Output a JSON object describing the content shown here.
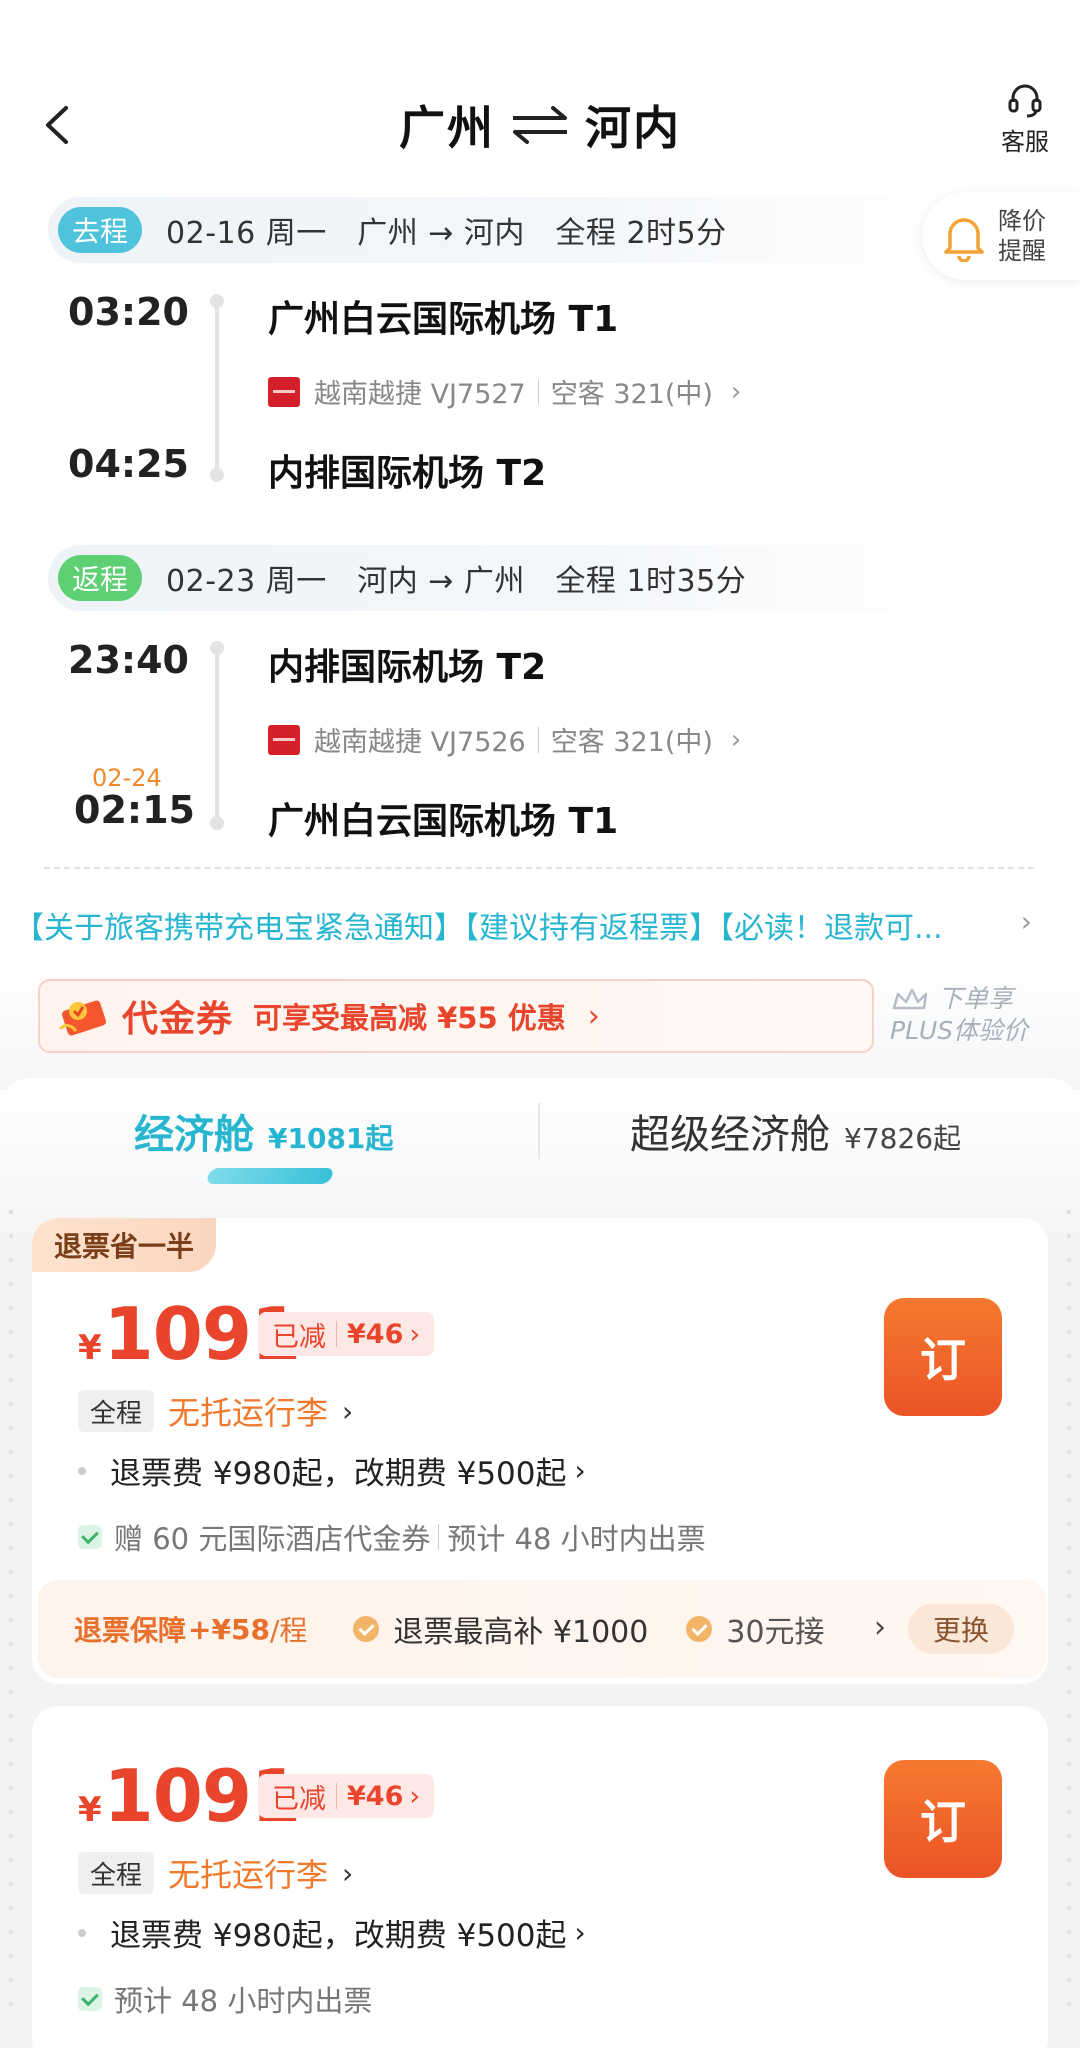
{
  "header": {
    "from_city": "广州",
    "to_city": "河内",
    "customer_service_label": "客服"
  },
  "price_alert": {
    "label": "降价提醒"
  },
  "outbound": {
    "tag": "去程",
    "info": "02-16 周一　广州 → 河内　全程 2时5分",
    "dep_time": "03:20",
    "dep_airport": "广州白云国际机场 T1",
    "airline_flight": "越南越捷 VJ7527",
    "aircraft": "空客 321(中)",
    "arr_time": "04:25",
    "arr_airport": "内排国际机场 T2"
  },
  "return": {
    "tag": "返程",
    "info": "02-23 周一　河内 → 广州　全程 1时35分",
    "dep_time": "23:40",
    "dep_airport": "内排国际机场 T2",
    "airline_flight": "越南越捷 VJ7526",
    "aircraft": "空客 321(中)",
    "arr_date": "02-24",
    "arr_time": "02:15",
    "arr_airport": "广州白云国际机场 T1"
  },
  "notice": "【关于旅客携带充电宝紧急通知】【建议持有返程票】【必读！退款可...",
  "voucher": {
    "title": "代金券",
    "desc": "可享受最高减 ¥55 优惠",
    "plus_line1": "下单享",
    "plus_line2": "PLUS体验价"
  },
  "cabins": [
    {
      "name": "经济舱",
      "price": "¥1081起"
    },
    {
      "name": "超级经济舱",
      "price": "¥7826起"
    }
  ],
  "fares": [
    {
      "badge": "退票省一半",
      "price": "1091",
      "discount_label": "已减",
      "discount_value": "¥46",
      "book_label": "订",
      "bag_tag": "全程",
      "bag_text": "无托运行李",
      "refund_text": "退票费 ¥980起，改期费 ¥500起",
      "perks": [
        "赠 60 元国际酒店代金券",
        "预计 48 小时内出票"
      ],
      "insurance": {
        "title": "退票保障",
        "price": "+¥58",
        "unit": "/程",
        "item1": "退票最高补 ¥1000",
        "item2": "30元接",
        "swap_label": "更换"
      }
    },
    {
      "price": "1091",
      "discount_label": "已减",
      "discount_value": "¥46",
      "book_label": "订",
      "bag_tag": "全程",
      "bag_text": "无托运行李",
      "refund_text": "退票费 ¥980起，改期费 ¥500起",
      "perks": [
        "预计 48 小时内出票"
      ]
    }
  ],
  "currency_symbol": "¥",
  "colors": {
    "accent": "#27b5d0",
    "price": "#e8452c",
    "book": "#ea5427",
    "go_tag": "#4fc3dc",
    "back_tag": "#5fcf74"
  }
}
